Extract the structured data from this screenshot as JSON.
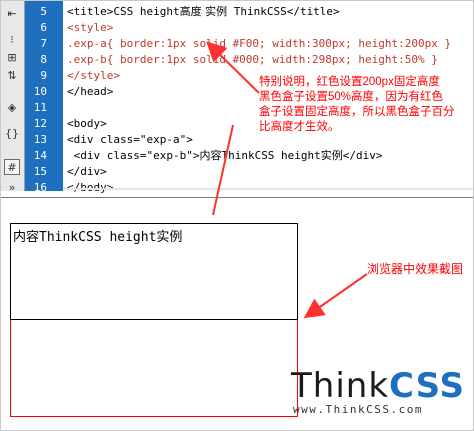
{
  "editor": {
    "line_numbers": [
      "5",
      "6",
      "7",
      "8",
      "9",
      "10",
      "11",
      "12",
      "13",
      "14",
      "15",
      "16"
    ],
    "lines": [
      {
        "parts": [
          {
            "t": "<title>CSS height",
            "c": "pl"
          },
          {
            "t": "高度 实例",
            "c": "pl zh"
          },
          {
            "t": " ThinkCSS</title>",
            "c": "pl"
          }
        ]
      },
      {
        "parts": [
          {
            "t": "<style>",
            "c": "cn"
          }
        ]
      },
      {
        "parts": [
          {
            "t": ".exp-a{ border:1px solid #F00; width:300px; height:200px }",
            "c": "cn"
          }
        ]
      },
      {
        "parts": [
          {
            "t": ".exp-b{ border:1px solid #000; width:298px; height:50% }",
            "c": "cn"
          }
        ]
      },
      {
        "parts": [
          {
            "t": "</style>",
            "c": "cn"
          }
        ]
      },
      {
        "parts": [
          {
            "t": "</head>",
            "c": "pl"
          }
        ]
      },
      {
        "parts": [
          {
            "t": "",
            "c": "pl"
          }
        ]
      },
      {
        "parts": [
          {
            "t": "<body>",
            "c": "pl"
          }
        ]
      },
      {
        "parts": [
          {
            "t": "<div class=\"exp-a\">",
            "c": "pl"
          }
        ]
      },
      {
        "parts": [
          {
            "t": " <div class=\"exp-b\">",
            "c": "pl"
          },
          {
            "t": "内容",
            "c": "pl zh"
          },
          {
            "t": "ThinkCSS height",
            "c": "pl"
          },
          {
            "t": "实例",
            "c": "pl zh"
          },
          {
            "t": "</div>",
            "c": "pl"
          }
        ]
      },
      {
        "parts": [
          {
            "t": "</div>",
            "c": "pl"
          }
        ]
      },
      {
        "parts": [
          {
            "t": "</body>",
            "c": "pl"
          }
        ]
      }
    ]
  },
  "annotation": {
    "lines": [
      "特别说明，红色设置200px固定高度",
      "黑色盒子设置50%高度，因为有红色",
      "盒子设置固定高度，所以黑色盒子百分",
      "比高度才生效。"
    ]
  },
  "preview": {
    "box_text": "内容ThinkCSS height实例",
    "caption": "浏览器中效果截图"
  },
  "logo": {
    "main_thin": "Think",
    "main_bold": "CSS",
    "sub": "www.ThinkCSS.com"
  },
  "toolbar": {
    "icons": [
      "code-collapse-icon",
      "collapse-full-tag-icon",
      "collapse-selection-icon",
      "expand-all-icon",
      "select-parent-tag-icon",
      "balance-braces-icon",
      "line-numbers-icon",
      "highlight-invalid-icon",
      "more-icon"
    ]
  },
  "colors": {
    "gutter": "#1f6fbf",
    "annotation": "#ff0000",
    "box_a_border": "#ff0000",
    "box_b_border": "#000000",
    "logo_accent": "#1f6fbf"
  }
}
